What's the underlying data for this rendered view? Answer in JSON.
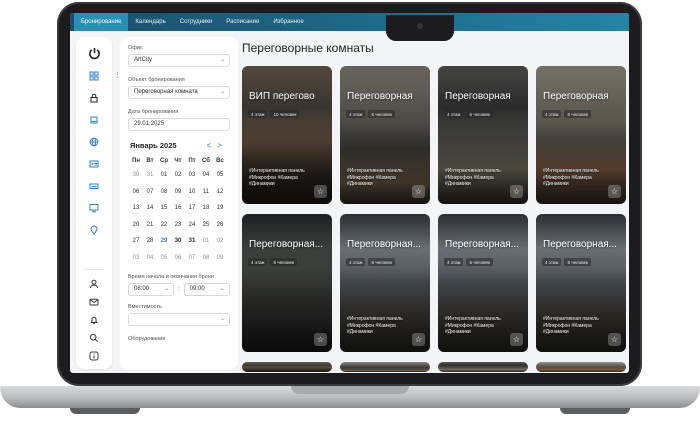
{
  "nav": {
    "tabs": [
      "Бронирование",
      "Календарь",
      "Сотрудники",
      "Расписание",
      "Избранное"
    ],
    "active_index": 0
  },
  "rail_icons": [
    "power-icon",
    "grid-icon",
    "lock-icon",
    "laptop-icon",
    "globe-icon",
    "id-card-icon",
    "printer-icon",
    "monitor-icon",
    "location-pin-icon",
    "user-icon",
    "mail-icon",
    "bell-icon",
    "search-icon",
    "info-icon"
  ],
  "filters": {
    "office_label": "Офис",
    "office_value": "ArtCity",
    "object_label": "Объект бронирования",
    "object_value": "Переговорная комната",
    "date_label": "Дата бронирования",
    "date_value": "29.01.2025",
    "calendar": {
      "month": "Январь 2025",
      "prev": "<",
      "next": ">",
      "weekdays": [
        "Пн",
        "Вт",
        "Ср",
        "Чт",
        "Пт",
        "Сб",
        "Вс"
      ],
      "rows": [
        [
          "30",
          "31",
          "01",
          "02",
          "03",
          "04",
          "05"
        ],
        [
          "06",
          "07",
          "08",
          "09",
          "10",
          "11",
          "12"
        ],
        [
          "13",
          "14",
          "15",
          "16",
          "17",
          "18",
          "19"
        ],
        [
          "20",
          "21",
          "22",
          "23",
          "24",
          "25",
          "26"
        ],
        [
          "27",
          "28",
          "29",
          "30",
          "31",
          "01",
          "02"
        ],
        [
          "03",
          "04",
          "05",
          "06",
          "07",
          "08",
          "09"
        ]
      ],
      "selected": "29"
    },
    "time_label": "Время начала и окончания брони",
    "time_start": "08:00",
    "time_sep": ":",
    "time_end": "09:00",
    "capacity_label": "Вместимость",
    "capacity_value": "",
    "equipment_label": "Оборудование"
  },
  "main": {
    "title": "Переговорные комнаты",
    "cards": [
      {
        "name": "ВИП перегово",
        "floor": "4 этаж",
        "people": "10 человек",
        "tags": "#Интерактивная панель #Микрофон #Камера #Динамики"
      },
      {
        "name": "Переговорная",
        "floor": "4 этаж",
        "people": "6 человек",
        "tags": "#Интерактивная панель #Микрофон #Камера #Динамики"
      },
      {
        "name": "Переговорная",
        "floor": "4 этаж",
        "people": "6 человек",
        "tags": "#Интерактивная панель #Микрофон #Камера #Динамики"
      },
      {
        "name": "Переговорная",
        "floor": "4 этаж",
        "people": "6 человек",
        "tags": "#Интерактивная панель #Микрофон #Камера #Динамики"
      },
      {
        "name": "Переговорная...",
        "floor": "4 этаж",
        "people": "6 человек",
        "tags": ""
      },
      {
        "name": "Переговорная...",
        "floor": "4 этаж",
        "people": "6 человек",
        "tags": "#Интерактивная панель #Микрофон #Камера #Динамики"
      },
      {
        "name": "Переговорная...",
        "floor": "4 этаж",
        "people": "6 человек",
        "tags": "#Интерактивная панель #Микрофон #Камера #Динамики"
      },
      {
        "name": "Переговорная...",
        "floor": "4 этаж",
        "people": "6 человек",
        "tags": "#Интерактивная панель #Микрофон #Камера #Динамики"
      }
    ],
    "favorite_symbol": "☆"
  }
}
